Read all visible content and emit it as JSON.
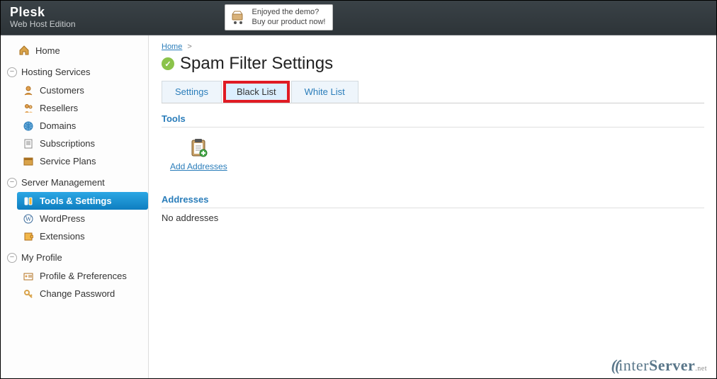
{
  "header": {
    "brand": "Plesk",
    "edition": "Web Host Edition",
    "promo1": "Enjoyed the demo?",
    "promo2": "Buy our product now!"
  },
  "sidebar": {
    "home": "Home",
    "hosting": {
      "title": "Hosting Services",
      "items": [
        "Customers",
        "Resellers",
        "Domains",
        "Subscriptions",
        "Service Plans"
      ]
    },
    "server": {
      "title": "Server Management",
      "items": [
        "Tools & Settings",
        "WordPress",
        "Extensions"
      ],
      "active": "Tools & Settings"
    },
    "profile": {
      "title": "My Profile",
      "items": [
        "Profile & Preferences",
        "Change Password"
      ]
    }
  },
  "breadcrumb": {
    "home": "Home"
  },
  "page": {
    "title": "Spam Filter Settings",
    "tabs": [
      "Settings",
      "Black List",
      "White List"
    ],
    "highlighted_tab": "Black List",
    "tools_label": "Tools",
    "add_addresses": "Add Addresses",
    "addresses_label": "Addresses",
    "empty": "No addresses"
  },
  "footer": {
    "brand": "interServer",
    "suffix": ".net"
  }
}
